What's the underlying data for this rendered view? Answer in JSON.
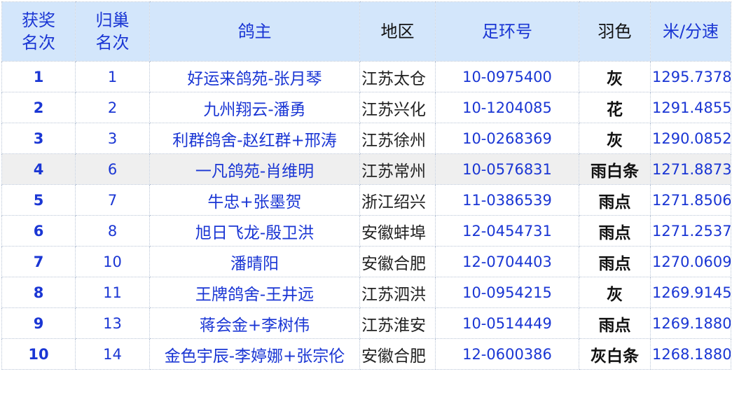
{
  "header": {
    "award_rank": [
      "获奖",
      "名次"
    ],
    "homing_rank": [
      "归巢",
      "名次"
    ],
    "owner": "鸽主",
    "region": "地区",
    "ring_no": "足环号",
    "color": "羽色",
    "speed": "米/分速"
  },
  "rows": [
    {
      "award": "1",
      "homing": "1",
      "owner": "好运来鸽苑-张月琴",
      "region": "江苏太仓",
      "ring": "10-0975400",
      "color": "灰",
      "speed": "1295.7378"
    },
    {
      "award": "2",
      "homing": "2",
      "owner": "九州翔云-潘勇",
      "region": "江苏兴化",
      "ring": "10-1204085",
      "color": "花",
      "speed": "1291.4855"
    },
    {
      "award": "3",
      "homing": "3",
      "owner": "利群鸽舍-赵红群+邢涛",
      "region": "江苏徐州",
      "ring": "10-0268369",
      "color": "灰",
      "speed": "1290.0852"
    },
    {
      "award": "4",
      "homing": "6",
      "owner": "一凡鸽苑-肖维明",
      "region": "江苏常州",
      "ring": "10-0576831",
      "color": "雨白条",
      "speed": "1271.8873"
    },
    {
      "award": "5",
      "homing": "7",
      "owner": "牛忠+张墨贺",
      "region": "浙江绍兴",
      "ring": "11-0386539",
      "color": "雨点",
      "speed": "1271.8506"
    },
    {
      "award": "6",
      "homing": "8",
      "owner": "旭日飞龙-殷卫洪",
      "region": "安徽蚌埠",
      "ring": "12-0454731",
      "color": "雨点",
      "speed": "1271.2537"
    },
    {
      "award": "7",
      "homing": "10",
      "owner": "潘晴阳",
      "region": "安徽合肥",
      "ring": "12-0704403",
      "color": "雨点",
      "speed": "1270.0609"
    },
    {
      "award": "8",
      "homing": "11",
      "owner": "王牌鸽舍-王井远",
      "region": "江苏泗洪",
      "ring": "10-0954215",
      "color": "灰",
      "speed": "1269.9145"
    },
    {
      "award": "9",
      "homing": "13",
      "owner": "蒋会金+李树伟",
      "region": "江苏淮安",
      "ring": "10-0514449",
      "color": "雨点",
      "speed": "1269.1880"
    },
    {
      "award": "10",
      "homing": "14",
      "owner": "金色宇辰-李婷娜+张宗伦",
      "region": "安徽合肥",
      "ring": "12-0600386",
      "color": "灰白条",
      "speed": "1268.1880"
    }
  ],
  "colors": {
    "header_bg": "#d3e6fb",
    "header_text": "#1a36d4",
    "value_text": "#1a36d4",
    "highlight_row_bg": "#efefef"
  }
}
